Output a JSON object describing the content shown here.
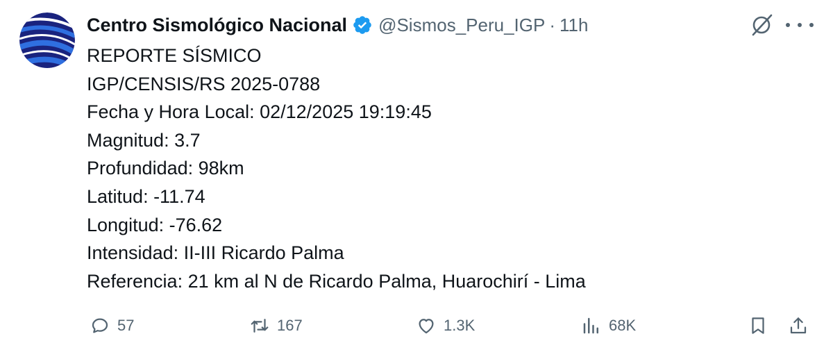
{
  "author": {
    "display_name": "Centro Sismológico Nacional",
    "handle": "@Sismos_Peru_IGP",
    "separator": "·",
    "time": "11h",
    "avatar_icon": "igp-logo-icon",
    "verified_icon": "verified-badge-icon"
  },
  "colors": {
    "verified": "#1d9bf0",
    "muted": "#536471",
    "text": "#0f1419",
    "avatar_blue": "#1f5fd6",
    "avatar_navy": "#1a237e"
  },
  "report": {
    "title": "REPORTE SÍSMICO",
    "code": "IGP/CENSIS/RS 2025-0788",
    "datetime": "Fecha y Hora Local: 02/12/2025 19:19:45",
    "magnitude": "Magnitud: 3.7",
    "depth": "Profundidad: 98km",
    "latitude": "Latitud: -11.74",
    "longitude": "Longitud: -76.62",
    "intensity": "Intensidad: II-III Ricardo Palma",
    "reference": "Referencia: 21 km al N de Ricardo Palma, Huarochirí - Lima"
  },
  "actions": {
    "replies": {
      "icon": "reply-icon",
      "count": "57"
    },
    "reposts": {
      "icon": "repost-icon",
      "count": "167"
    },
    "likes": {
      "icon": "like-icon",
      "count": "1.3K"
    },
    "views": {
      "icon": "views-icon",
      "count": "68K"
    },
    "bookmark": {
      "icon": "bookmark-icon"
    },
    "share": {
      "icon": "share-icon"
    }
  }
}
